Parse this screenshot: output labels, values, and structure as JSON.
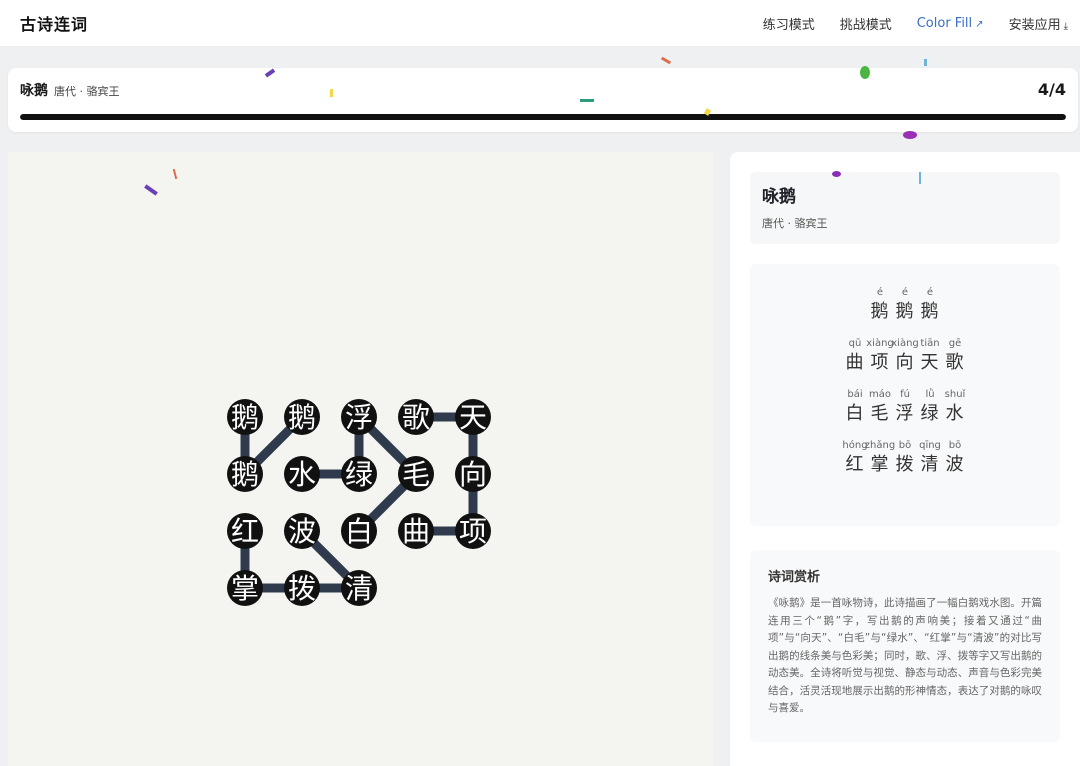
{
  "app": {
    "brand": "古诗连词"
  },
  "nav": {
    "practice": "练习模式",
    "challenge": "挑战模式",
    "color_fill": "Color Fill",
    "install": "安装应用"
  },
  "progress": {
    "title": "咏鹅",
    "meta": "唐代 · 骆宾王",
    "count": "4/4",
    "fraction": 1.0
  },
  "board": {
    "rows": [
      [
        "鹅",
        "鹅",
        "浮",
        "歌",
        "天"
      ],
      [
        "鹅",
        "水",
        "绿",
        "毛",
        "向"
      ],
      [
        "红",
        "波",
        "白",
        "曲",
        "项"
      ],
      [
        "掌",
        "拨",
        "清"
      ]
    ],
    "paths": [
      [
        [
          0,
          0
        ],
        [
          0,
          1
        ],
        [
          1,
          0
        ]
      ],
      [
        [
          3,
          0
        ],
        [
          4,
          0
        ],
        [
          4,
          1
        ],
        [
          4,
          2
        ],
        [
          3,
          2
        ]
      ],
      [
        [
          2,
          2
        ],
        [
          3,
          1
        ],
        [
          2,
          0
        ],
        [
          2,
          1
        ],
        [
          1,
          1
        ]
      ],
      [
        [
          0,
          2
        ],
        [
          0,
          3
        ],
        [
          1,
          3
        ],
        [
          2,
          3
        ],
        [
          1,
          2
        ]
      ]
    ]
  },
  "poem": {
    "title": "咏鹅",
    "meta": "唐代 · 骆宾王",
    "lines": [
      {
        "chars": [
          "鹅",
          "鹅",
          "鹅"
        ],
        "pinyin": [
          "é",
          "é",
          "é"
        ]
      },
      {
        "chars": [
          "曲",
          "项",
          "向",
          "天",
          "歌"
        ],
        "pinyin": [
          "qū",
          "xiàng",
          "xiàng",
          "tiān",
          "gē"
        ]
      },
      {
        "chars": [
          "白",
          "毛",
          "浮",
          "绿",
          "水"
        ],
        "pinyin": [
          "bái",
          "máo",
          "fú",
          "lǜ",
          "shuǐ"
        ]
      },
      {
        "chars": [
          "红",
          "掌",
          "拨",
          "清",
          "波"
        ],
        "pinyin": [
          "hóng",
          "zhǎng",
          "bō",
          "qīng",
          "bō"
        ]
      }
    ]
  },
  "analysis": {
    "title": "诗词赏析",
    "text": "《咏鹅》是一首咏物诗，此诗描画了一幅白鹅戏水图。开篇连用三个“鹅”字，写出鹅的声响美；接着又通过“曲项”与“向天”、“白毛”与“绿水”、“红掌”与“清波”的对比写出鹅的线条美与色彩美；同时，歌、浮、拨等字又写出鹅的动态美。全诗将听觉与视觉、静态与动态、声音与色彩完美结合，活灵活现地展示出鹅的形神情态，表达了对鹅的咏叹与喜爱。"
  },
  "icons": {
    "external_link": "external-link-icon",
    "download": "download-icon"
  },
  "colors": {
    "accent": "#3a6fc4",
    "cell": "#111111",
    "path": "#2f3b4d"
  }
}
